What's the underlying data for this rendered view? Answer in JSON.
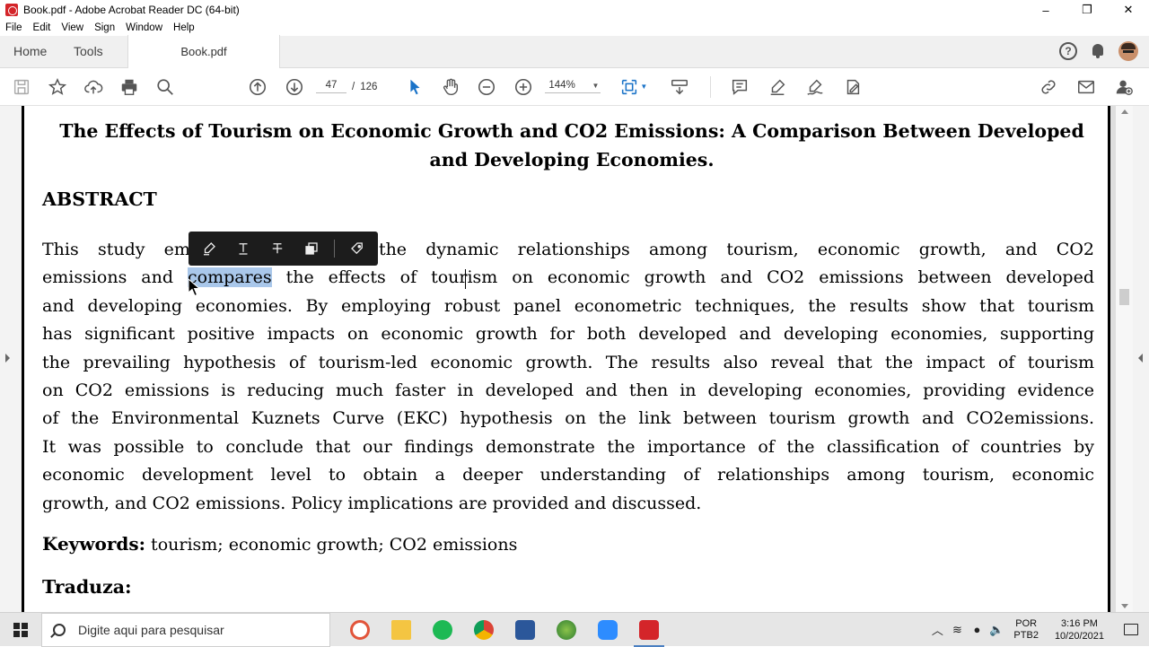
{
  "window": {
    "title": "Book.pdf - Adobe Acrobat Reader DC (64-bit)",
    "minimize": "–",
    "restore": "❐",
    "close": "✕"
  },
  "menu": [
    "File",
    "Edit",
    "View",
    "Sign",
    "Window",
    "Help"
  ],
  "tabs": {
    "home": "Home",
    "tools": "Tools",
    "document": "Book.pdf"
  },
  "toolbar": {
    "page_current": "47",
    "page_separator": "/",
    "page_total": "126",
    "zoom": "144%"
  },
  "document": {
    "title_line1": "The Effects of Tourism on Economic Growth and CO2 Emissions: A Comparison Between Developed",
    "title_line2": "and Developing Economies.",
    "abstract_heading": "ABSTRACT",
    "abstract_lines": [
      {
        "pre": "This study em",
        "hl": "",
        "post": "the dynamic relationships among tourism, economic growth, and CO2"
      },
      {
        "pre": "emissions and ",
        "hl": "compares",
        "post": " the effects of tourism on economic growth and CO2 emissions between developed"
      },
      {
        "pre": "and developing economies. By employing robust panel econometric techniques, the results show that tourism",
        "hl": "",
        "post": ""
      },
      {
        "pre": "has significant positive impacts on economic growth for both developed and developing economies, supporting",
        "hl": "",
        "post": ""
      },
      {
        "pre": "the prevailing hypothesis of tourism-led economic growth. The results also reveal that the impact of tourism",
        "hl": "",
        "post": ""
      },
      {
        "pre": "on CO2 emissions is reducing much faster in developed and then in developing economies, providing evidence",
        "hl": "",
        "post": ""
      },
      {
        "pre": "of the Environmental Kuznets Curve (EKC) hypothesis on the link between tourism growth and CO2emissions.",
        "hl": "",
        "post": ""
      },
      {
        "pre": "It was possible to conclude that our findings demonstrate the importance of the classification of countries by",
        "hl": "",
        "post": ""
      },
      {
        "pre": "economic development level to obtain a deeper understanding of relationships among tourism, economic",
        "hl": "",
        "post": ""
      },
      {
        "pre": "growth, and CO2 emissions. Policy implications are provided and discussed.",
        "hl": "",
        "post": ""
      }
    ],
    "keywords_label": "Keywords:",
    "keywords_value": " tourism; economic growth; CO2 emissions",
    "traduza": "Traduza:"
  },
  "taskbar": {
    "search_placeholder": "Digite aqui para pesquisar",
    "lang_top": "POR",
    "lang_bottom": "PTB2",
    "time": "3:16 PM",
    "date": "10/20/2021"
  },
  "colors": {
    "highlight": "#a9c7ea",
    "acrobat_red": "#d4252a",
    "toolbar_blue": "#1a73c8"
  }
}
